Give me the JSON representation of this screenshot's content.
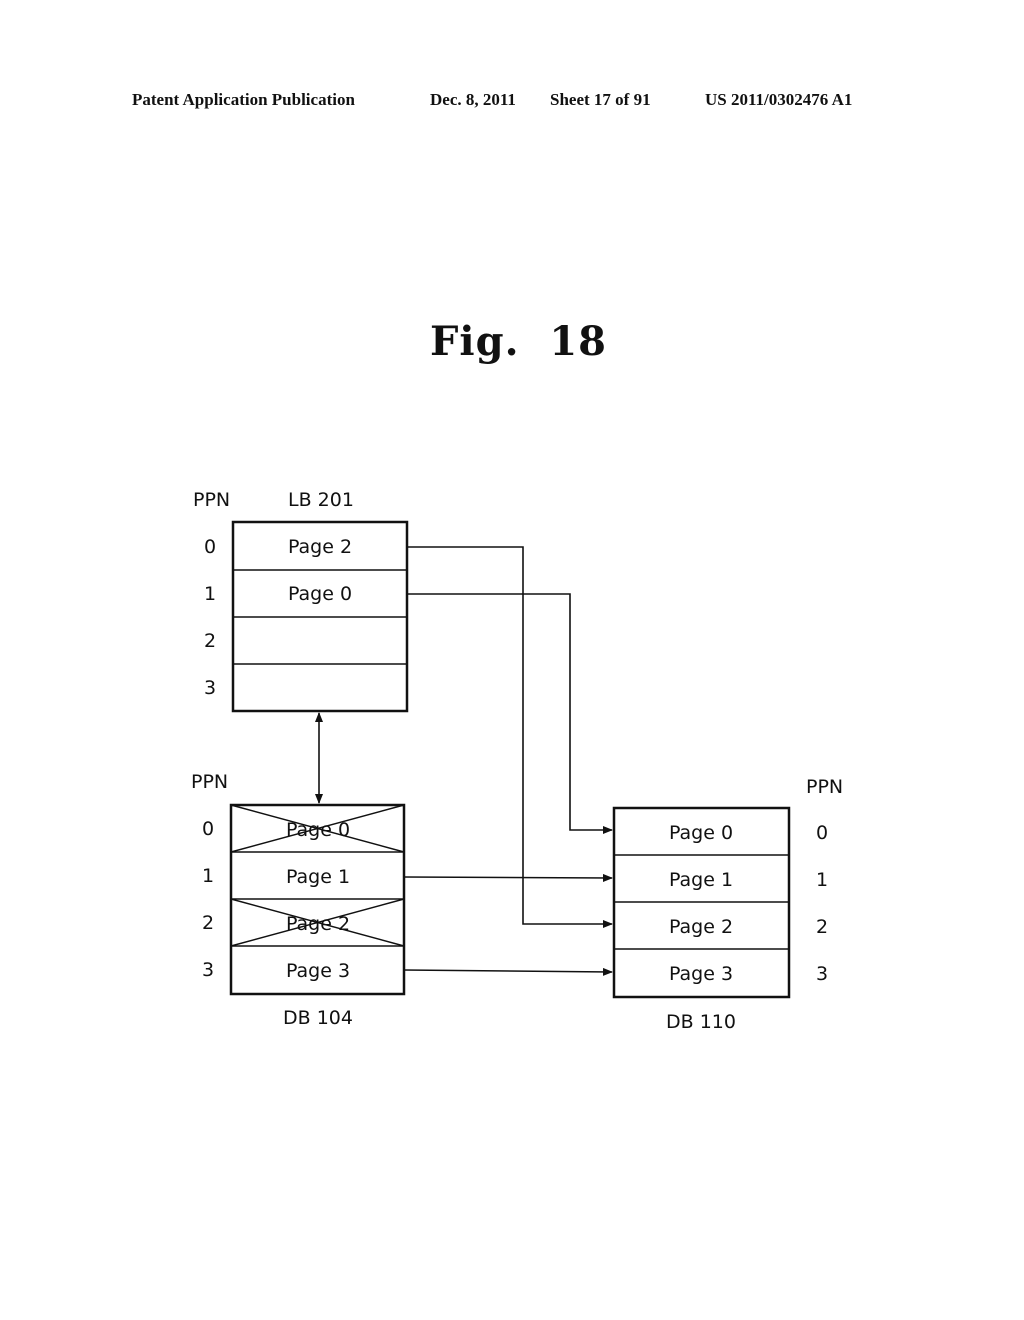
{
  "header": {
    "left": "Patent Application Publication",
    "date": "Dec. 8, 2011",
    "sheet": "Sheet 17 of 91",
    "number": "US 2011/0302476 A1"
  },
  "figure": {
    "title": "Fig.  18",
    "blocks": {
      "lb201": {
        "label": "LB 201",
        "ppn_header": "PPN",
        "ppn": [
          "0",
          "1",
          "2",
          "3"
        ],
        "cells": [
          "Page 2",
          "Page 0",
          "",
          ""
        ],
        "invalid": [
          false,
          false,
          false,
          false
        ]
      },
      "db104": {
        "label": "DB 104",
        "ppn_header": "PPN",
        "ppn": [
          "0",
          "1",
          "2",
          "3"
        ],
        "cells": [
          "Page 0",
          "Page 1",
          "Page 2",
          "Page 3"
        ],
        "invalid": [
          true,
          false,
          true,
          false
        ]
      },
      "db110": {
        "label": "DB 110",
        "ppn_header": "PPN",
        "ppn": [
          "0",
          "1",
          "2",
          "3"
        ],
        "cells": [
          "Page 0",
          "Page 1",
          "Page 2",
          "Page 3"
        ],
        "invalid": [
          false,
          false,
          false,
          false
        ]
      }
    },
    "connections": [
      {
        "from": "LB 201 PPN 0 (Page 2)",
        "to": "DB 110 PPN 2"
      },
      {
        "from": "LB 201 PPN 1 (Page 0)",
        "to": "DB 110 PPN 0"
      },
      {
        "from": "DB 104 PPN 1 (Page 1)",
        "to": "DB 110 PPN 1"
      },
      {
        "from": "DB 104 PPN 3 (Page 3)",
        "to": "DB 110 PPN 3"
      },
      {
        "from": "LB 201",
        "to": "DB 104",
        "type": "bidirectional"
      }
    ]
  }
}
